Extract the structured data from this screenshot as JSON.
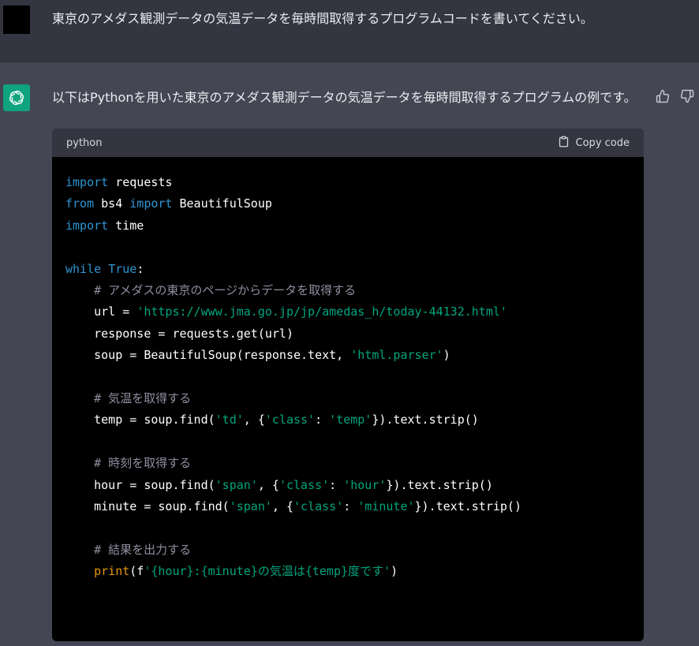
{
  "user_message": {
    "text": "東京のアメダス観測データの気温データを毎時間取得するプログラムコードを書いてください。"
  },
  "assistant_message": {
    "intro": "以下はPythonを用いた東京のアメダス観測データの気温データを毎時間取得するプログラムの例です。",
    "code_block": {
      "language": "python",
      "copy_label": "Copy code",
      "lines": [
        [
          {
            "t": "import",
            "c": "kw"
          },
          {
            "t": " requests",
            "c": ""
          }
        ],
        [
          {
            "t": "from",
            "c": "kw"
          },
          {
            "t": " bs4 ",
            "c": ""
          },
          {
            "t": "import",
            "c": "kw"
          },
          {
            "t": " BeautifulSoup",
            "c": ""
          }
        ],
        [
          {
            "t": "import",
            "c": "kw"
          },
          {
            "t": " time",
            "c": ""
          }
        ],
        [],
        [
          {
            "t": "while",
            "c": "kw"
          },
          {
            "t": " ",
            "c": ""
          },
          {
            "t": "True",
            "c": "kw"
          },
          {
            "t": ":",
            "c": ""
          }
        ],
        [
          {
            "t": "    ",
            "c": ""
          },
          {
            "t": "# アメダスの東京のページからデータを取得する",
            "c": "cm"
          }
        ],
        [
          {
            "t": "    url = ",
            "c": ""
          },
          {
            "t": "'https://www.jma.go.jp/jp/amedas_h/today-44132.html'",
            "c": "str"
          }
        ],
        [
          {
            "t": "    response = requests.get(url)",
            "c": ""
          }
        ],
        [
          {
            "t": "    soup = BeautifulSoup(response.text, ",
            "c": ""
          },
          {
            "t": "'html.parser'",
            "c": "str"
          },
          {
            "t": ")",
            "c": ""
          }
        ],
        [],
        [
          {
            "t": "    ",
            "c": ""
          },
          {
            "t": "# 気温を取得する",
            "c": "cm"
          }
        ],
        [
          {
            "t": "    temp = soup.find(",
            "c": ""
          },
          {
            "t": "'td'",
            "c": "str"
          },
          {
            "t": ", {",
            "c": ""
          },
          {
            "t": "'class'",
            "c": "str"
          },
          {
            "t": ": ",
            "c": ""
          },
          {
            "t": "'temp'",
            "c": "str"
          },
          {
            "t": "}).text.strip()",
            "c": ""
          }
        ],
        [],
        [
          {
            "t": "    ",
            "c": ""
          },
          {
            "t": "# 時刻を取得する",
            "c": "cm"
          }
        ],
        [
          {
            "t": "    hour = soup.find(",
            "c": ""
          },
          {
            "t": "'span'",
            "c": "str"
          },
          {
            "t": ", {",
            "c": ""
          },
          {
            "t": "'class'",
            "c": "str"
          },
          {
            "t": ": ",
            "c": ""
          },
          {
            "t": "'hour'",
            "c": "str"
          },
          {
            "t": "}).text.strip()",
            "c": ""
          }
        ],
        [
          {
            "t": "    minute = soup.find(",
            "c": ""
          },
          {
            "t": "'span'",
            "c": "str"
          },
          {
            "t": ", {",
            "c": ""
          },
          {
            "t": "'class'",
            "c": "str"
          },
          {
            "t": ": ",
            "c": ""
          },
          {
            "t": "'minute'",
            "c": "str"
          },
          {
            "t": "}).text.strip()",
            "c": ""
          }
        ],
        [],
        [
          {
            "t": "    ",
            "c": ""
          },
          {
            "t": "# 結果を出力する",
            "c": "cm"
          }
        ],
        [
          {
            "t": "    ",
            "c": ""
          },
          {
            "t": "print",
            "c": "bi"
          },
          {
            "t": "(f",
            "c": ""
          },
          {
            "t": "'{hour}:{minute}の気温は{temp}度です'",
            "c": "str"
          },
          {
            "t": ")",
            "c": ""
          }
        ]
      ]
    }
  },
  "icons": {
    "assistant_avatar": "openai-logo-icon",
    "thumbs_up": "thumbs-up-icon",
    "thumbs_down": "thumbs-down-icon",
    "copy": "clipboard-icon"
  },
  "colors": {
    "user_row_bg": "#343541",
    "assistant_row_bg": "#444654",
    "avatar_bg": "#10a37f",
    "code_bg": "#000000",
    "keyword": "#2e95d3",
    "string": "#00a67d",
    "comment": "#8e8ea0"
  }
}
